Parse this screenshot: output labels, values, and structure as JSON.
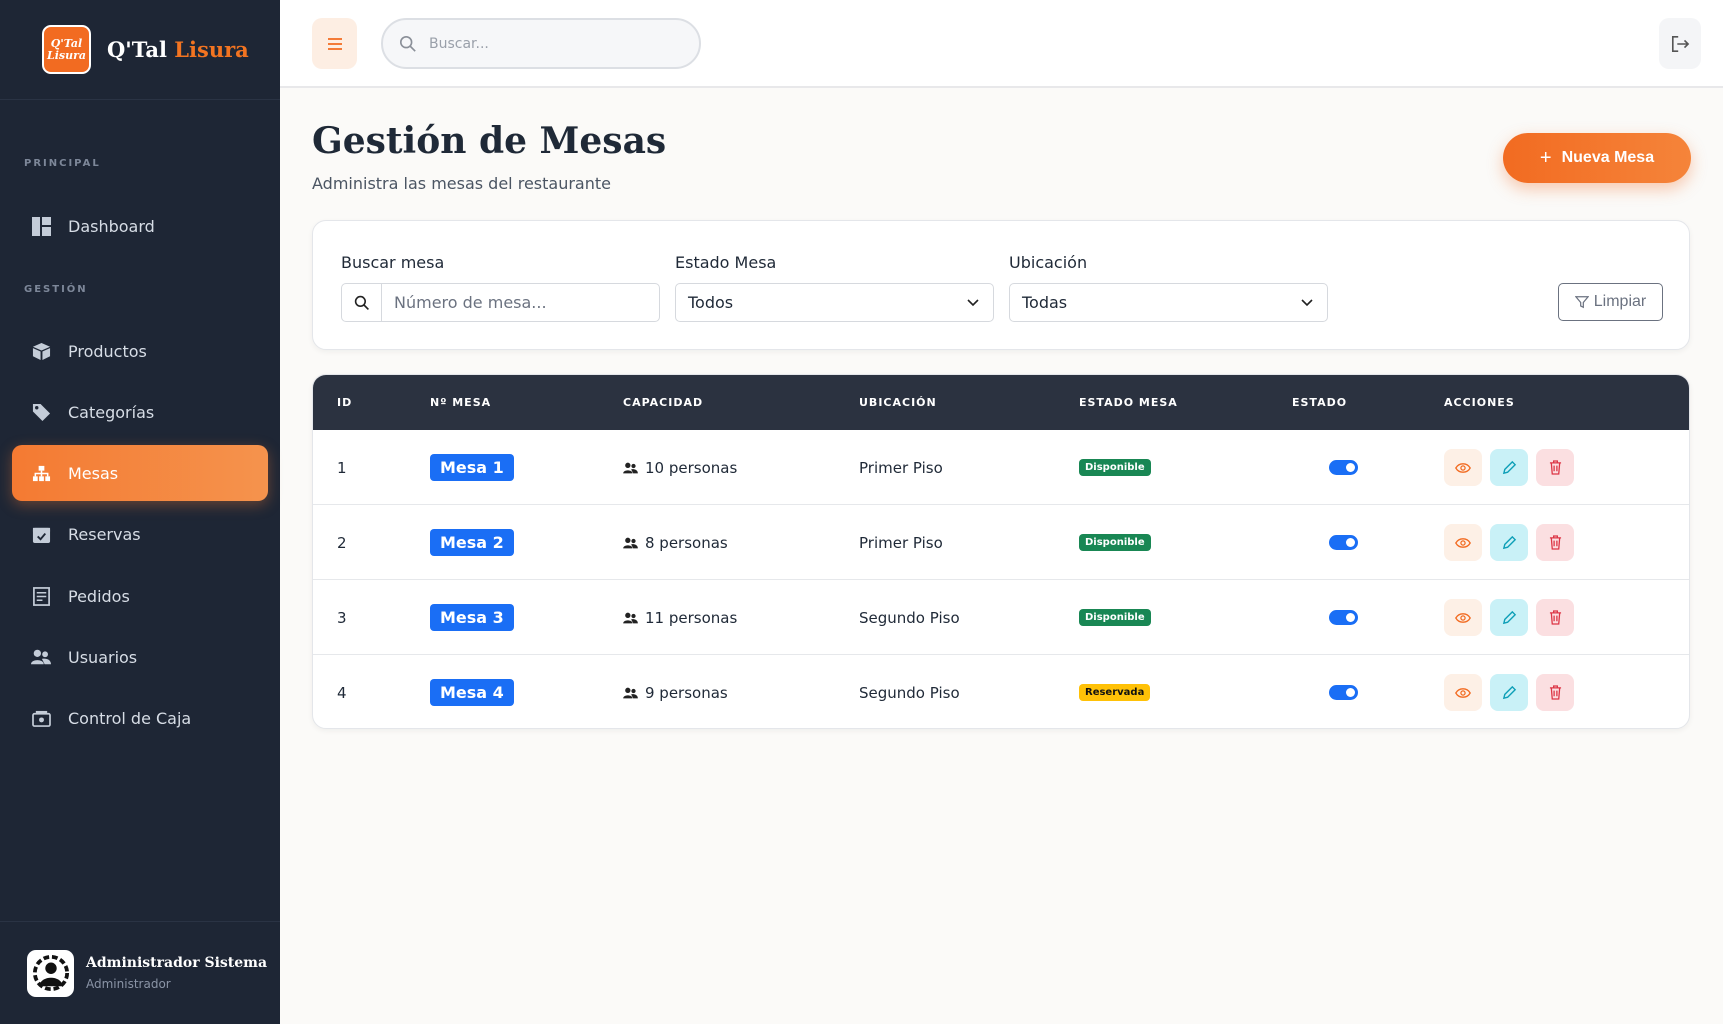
{
  "brand": {
    "name_part1": "Q'Tal",
    "name_part2": "Lisura",
    "logo_line1": "Q'Tal",
    "logo_line2": "Lisura"
  },
  "sidebar": {
    "section_principal": "PRINCIPAL",
    "section_gestion": "GESTIÓN",
    "items": [
      {
        "label": "Dashboard",
        "icon": "dashboard-icon"
      },
      {
        "label": "Productos",
        "icon": "box-icon"
      },
      {
        "label": "Categorías",
        "icon": "tag-icon"
      },
      {
        "label": "Mesas",
        "icon": "sitemap-icon",
        "active": true
      },
      {
        "label": "Reservas",
        "icon": "calendar-check-icon"
      },
      {
        "label": "Pedidos",
        "icon": "receipt-icon"
      },
      {
        "label": "Usuarios",
        "icon": "users-icon"
      },
      {
        "label": "Control de Caja",
        "icon": "cash-register-icon"
      }
    ],
    "user": {
      "name": "Administrador Sistema",
      "role": "Administrador"
    }
  },
  "topbar": {
    "search_placeholder": "Buscar..."
  },
  "page": {
    "title": "Gestión de Mesas",
    "subtitle": "Administra las mesas del restaurante",
    "new_button": "Nueva Mesa"
  },
  "filters": {
    "search_label": "Buscar mesa",
    "search_placeholder": "Número de mesa...",
    "estado_label": "Estado Mesa",
    "estado_value": "Todos",
    "ubicacion_label": "Ubicación",
    "ubicacion_value": "Todas",
    "clear_label": "Limpiar"
  },
  "table": {
    "headers": {
      "id": "ID",
      "mesa": "Nº MESA",
      "capacidad": "CAPACIDAD",
      "ubicacion": "UBICACIÓN",
      "estado_mesa": "ESTADO MESA",
      "estado": "ESTADO",
      "acciones": "ACCIONES"
    },
    "rows": [
      {
        "id": "1",
        "mesa": "Mesa 1",
        "capacidad": "10 personas",
        "ubicacion": "Primer Piso",
        "estado_mesa": "Disponible",
        "activo": true
      },
      {
        "id": "2",
        "mesa": "Mesa 2",
        "capacidad": "8 personas",
        "ubicacion": "Primer Piso",
        "estado_mesa": "Disponible",
        "activo": true
      },
      {
        "id": "3",
        "mesa": "Mesa 3",
        "capacidad": "11 personas",
        "ubicacion": "Segundo Piso",
        "estado_mesa": "Disponible",
        "activo": true
      },
      {
        "id": "4",
        "mesa": "Mesa 4",
        "capacidad": "9 personas",
        "ubicacion": "Segundo Piso",
        "estado_mesa": "Reservada",
        "activo": true
      }
    ]
  },
  "colors": {
    "accent": "#f26b21",
    "sidebar_bg": "#1e2635",
    "primary_blue": "#1a6ef5",
    "success": "#198754",
    "warning": "#ffc107"
  }
}
